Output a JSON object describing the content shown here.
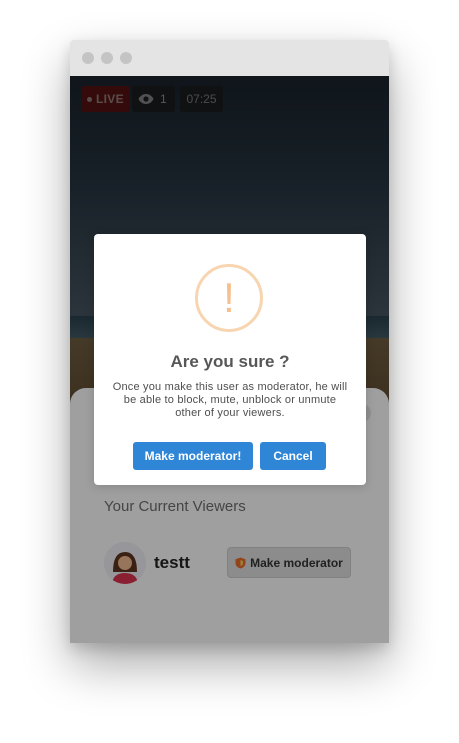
{
  "stream": {
    "live_label": "LIVE",
    "viewer_count": "1",
    "elapsed_time": "07:25"
  },
  "viewers_panel": {
    "title": "Your Current Viewers",
    "viewers": [
      {
        "name": "testt",
        "action_label": "Make moderator"
      }
    ]
  },
  "modal": {
    "icon": "!",
    "title": "Are you sure ?",
    "message": "Once you make this user as moderator, he will be able to block, mute, unblock or unmute other of your viewers.",
    "confirm_label": "Make moderator!",
    "cancel_label": "Cancel"
  },
  "colors": {
    "accent": "#2f86d6",
    "warning_icon": "#f5c08e",
    "live_badge": "#8b1c1c"
  }
}
